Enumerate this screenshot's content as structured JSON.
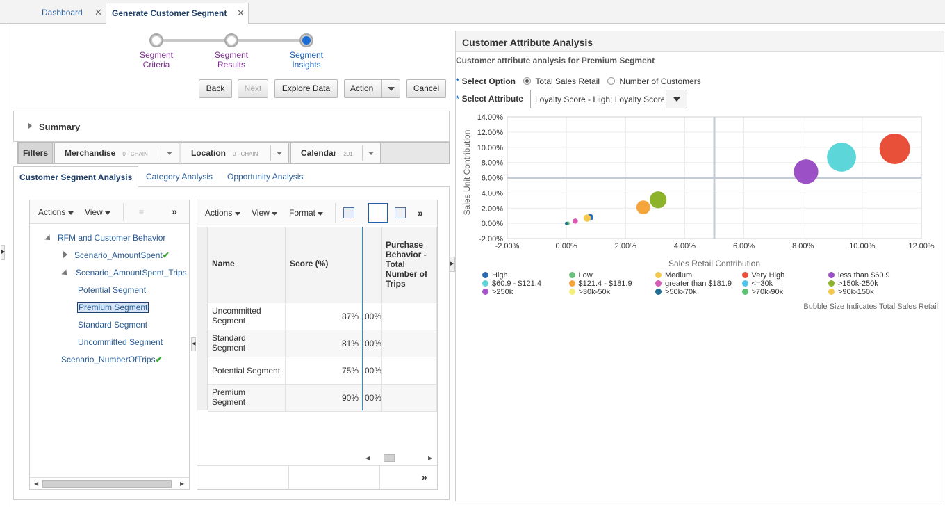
{
  "tabs": [
    {
      "label": "Dashboard",
      "close": "✕"
    },
    {
      "label": "Generate Customer Segment",
      "close": "✕"
    }
  ],
  "train": {
    "steps": [
      {
        "line1": "Segment",
        "line2": "Criteria"
      },
      {
        "line1": "Segment",
        "line2": "Results"
      },
      {
        "line1": "Segment",
        "line2": "Insights"
      }
    ],
    "current_step": 3
  },
  "buttons": {
    "back": "Back",
    "next": "Next",
    "explore": "Explore Data",
    "action": "Action",
    "cancel": "Cancel"
  },
  "summary": {
    "label": "Summary"
  },
  "filters": {
    "label": "Filters",
    "items": [
      {
        "name": "Merchandise",
        "sub": "0 - CHAIN"
      },
      {
        "name": "Location",
        "sub": "0 - CHAIN"
      },
      {
        "name": "Calendar",
        "sub": "201"
      }
    ]
  },
  "subtabs": [
    "Customer Segment Analysis",
    "Category Analysis",
    "Opportunity Analysis"
  ],
  "tree_toolbar": {
    "actions": "Actions",
    "view": "View",
    "more": "»"
  },
  "tree": {
    "root": "RFM and Customer Behavior",
    "scenario1": "Scenario_AmountSpent",
    "scenario2": "Scenario_AmountSpent_Trips",
    "segments": [
      "Potential Segment",
      "Premium Segment",
      "Standard Segment",
      "Uncommitted Segment"
    ],
    "scenario3": "Scenario_NumberOfTrips"
  },
  "grid_toolbar": {
    "actions": "Actions",
    "view": "View",
    "format": "Format",
    "more": "»"
  },
  "grid": {
    "headers": {
      "name": "Name",
      "score": "Score (%)",
      "purchase": "Purchase Behavior - Total Number of Trips"
    },
    "rows": [
      {
        "name": "Uncommitted Segment",
        "score": "87%",
        "extra": "00%"
      },
      {
        "name": "Standard Segment",
        "score": "81%",
        "extra": "00%"
      },
      {
        "name": "Potential Segment",
        "score": "75%",
        "extra": "00%"
      },
      {
        "name": "Premium Segment",
        "score": "90%",
        "extra": "00%"
      }
    ],
    "footer_more": "»"
  },
  "analysis": {
    "title": "Customer Attribute Analysis",
    "subtitle": "Customer attribute analysis for Premium Segment",
    "select_option_label": "Select Option",
    "option1": "Total Sales Retail",
    "option2": "Number of Customers",
    "select_attribute_label": "Select Attribute",
    "attribute_value": "Loyalty Score - High; Loyalty Score",
    "bubble_note": "Bubble Size Indicates Total Sales Retail"
  },
  "chart_data": {
    "type": "scatter",
    "xlabel": "Sales Retail Contribution",
    "ylabel": "Sales Unit Contribution",
    "xlim": [
      -2,
      12
    ],
    "ylim": [
      -2,
      14
    ],
    "x_ticks": [
      "-2.00%",
      "0.00%",
      "2.00%",
      "4.00%",
      "6.00%",
      "8.00%",
      "10.00%",
      "12.00%"
    ],
    "y_ticks": [
      "14.00%",
      "12.00%",
      "10.00%",
      "8.00%",
      "6.00%",
      "4.00%",
      "2.00%",
      "0.00%",
      "-2.00%"
    ],
    "x_tick_values": [
      -2,
      0,
      2,
      4,
      6,
      8,
      10,
      12
    ],
    "y_tick_values": [
      14,
      12,
      10,
      8,
      6,
      4,
      2,
      0,
      -2
    ],
    "reference_lines": {
      "x": 5.0,
      "y": 6.0
    },
    "points": [
      {
        "series": "Very High",
        "x": 11.1,
        "y": 9.8,
        "size": 10,
        "color": "#e8503a"
      },
      {
        "series": "<=30k",
        "x": 9.3,
        "y": 8.7,
        "size": 9.5,
        "color": "#5cd6d9"
      },
      {
        "series": "less than $60.9",
        "x": 8.1,
        "y": 6.8,
        "size": 8,
        "color": "#9b50c6"
      },
      {
        "series": ">150k-250k",
        "x": 3.1,
        "y": 3.1,
        "size": 5.5,
        "color": "#8db32a"
      },
      {
        "series": "$121.4 - $181.9",
        "x": 2.6,
        "y": 2.1,
        "size": 4.5,
        "color": "#f4a53c"
      },
      {
        "series": "High",
        "x": 0.8,
        "y": 0.8,
        "size": 2.2,
        "color": "#2b6cb3"
      },
      {
        "series": ">90k-150k",
        "x": 0.7,
        "y": 0.7,
        "size": 2.4,
        "color": "#f5c84c"
      },
      {
        "series": ">250k",
        "x": 0.3,
        "y": 0.3,
        "size": 1.7,
        "color": "#d95bb6"
      },
      {
        "series": ">70k-90k",
        "x": 0.05,
        "y": 0.0,
        "size": 1.2,
        "color": "#5cbf72"
      },
      {
        "series": ">50k-70k",
        "x": 0.0,
        "y": 0.0,
        "size": 1.0,
        "color": "#1f6f95"
      }
    ]
  },
  "legend": [
    {
      "label": "High",
      "color": "#2b6cb3"
    },
    {
      "label": "Low",
      "color": "#6cc07e"
    },
    {
      "label": "Medium",
      "color": "#f5c84c"
    },
    {
      "label": "Very High",
      "color": "#e8503a"
    },
    {
      "label": "less than $60.9",
      "color": "#9b50c6"
    },
    {
      "label": "$60.9 - $121.4",
      "color": "#5cd6d9"
    },
    {
      "label": "$121.4 - $181.9",
      "color": "#f4a53c"
    },
    {
      "label": "greater than $181.9",
      "color": "#d95bb6"
    },
    {
      "label": "<=30k",
      "color": "#4fc3e8"
    },
    {
      "label": ">150k-250k",
      "color": "#8db32a"
    },
    {
      "label": ">250k",
      "color": "#a555c7"
    },
    {
      "label": ">30k-50k",
      "color": "#f3f07a"
    },
    {
      "label": ">50k-70k",
      "color": "#1f6f95"
    },
    {
      "label": ">70k-90k",
      "color": "#5cbf72"
    },
    {
      "label": ">90k-150k",
      "color": "#f5c84c"
    }
  ]
}
